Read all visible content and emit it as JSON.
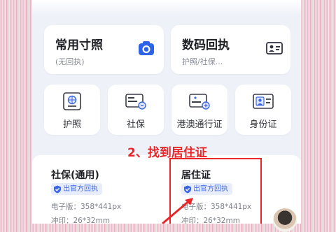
{
  "top_cards": [
    {
      "title": "常用寸照",
      "subtitle": "(无回执)",
      "icon": "camera-icon"
    },
    {
      "title": "数码回执",
      "subtitle": "护照/社保...",
      "icon": "id-card-icon"
    }
  ],
  "doc_types": [
    {
      "label": "护照",
      "icon": "passport-icon"
    },
    {
      "label": "社保",
      "icon": "social-security-card-icon"
    },
    {
      "label": "港澳通行证",
      "icon": "hk-macau-permit-icon"
    },
    {
      "label": "身份证",
      "icon": "id-card-portrait-icon"
    }
  ],
  "annotation": "2、找到居住证",
  "spec_cards": [
    {
      "title": "社保(通用)",
      "badge": "出官方回执",
      "lines": [
        "电子版：358*441px",
        "冲印：26*32mm"
      ]
    },
    {
      "title": "居住证",
      "badge": "出官方回执",
      "lines": [
        "电子版：358*441px",
        "冲印：26*32mm"
      ]
    }
  ],
  "colors": {
    "accent_blue": "#3d66e4",
    "annotation_red": "#e8262a",
    "badge_bg": "#e8edfc"
  }
}
